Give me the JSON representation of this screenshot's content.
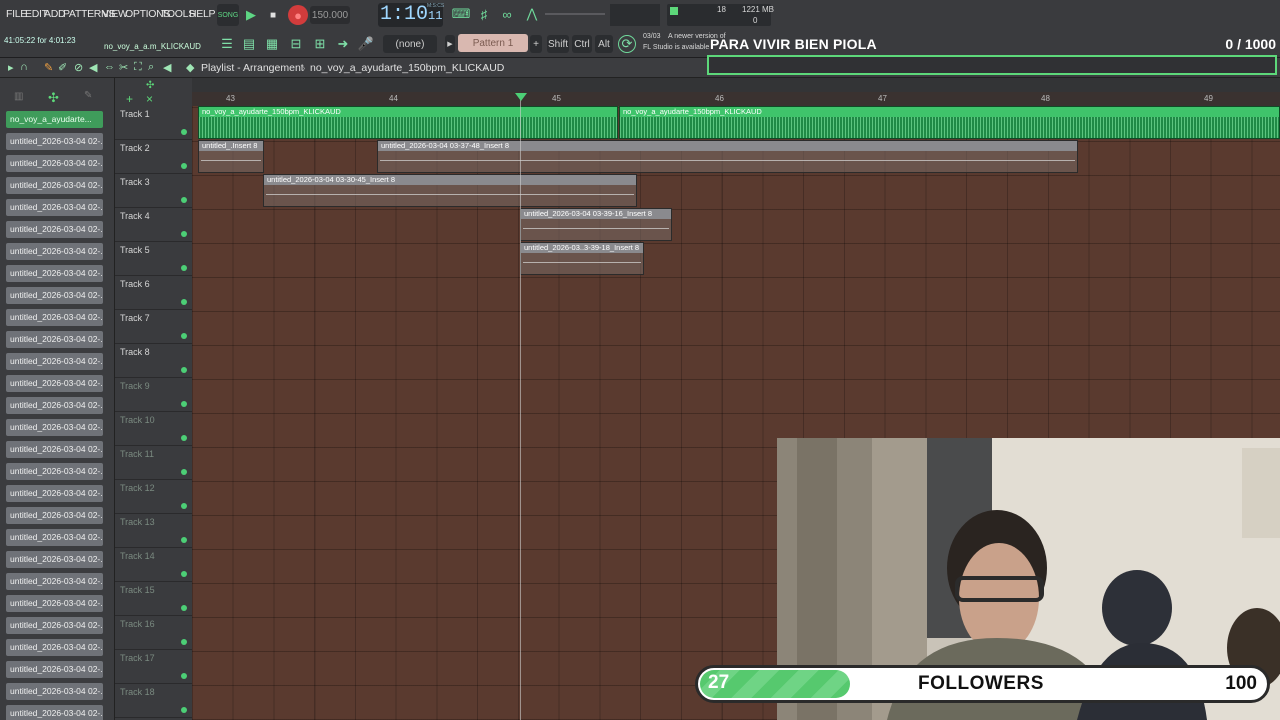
{
  "menu": [
    "FILE",
    "EDIT",
    "ADD",
    "PATTERNS",
    "VIEW",
    "OPTIONS",
    "TOOLS",
    "HELP"
  ],
  "transport": {
    "mode": "SONG",
    "tempo": "150.000",
    "time": "1:10",
    "time_small": "11",
    "time_label": "M:S:CS"
  },
  "status": {
    "cpu": "18",
    "mem": "1221 MB",
    "voices": "0",
    "elapsed": "41:05:22 for 4:01:23",
    "project_short": "no_voy_a_a.m_KLICKAUD"
  },
  "toolbar": {
    "snap": "(none)",
    "pattern": "Pattern 1",
    "shift": "Shift",
    "ctrl": "Ctrl",
    "alt": "Alt",
    "update_date": "03/03",
    "update_text1": "A newer version of",
    "update_text2": "FL Studio is available"
  },
  "stream": {
    "title": "PARA VIVIR BIEN PIOLA",
    "count": "0",
    "goal": "/ 1000"
  },
  "playlist": {
    "title": "Playlist - Arrangement",
    "song": "no_voy_a_ayudarte_150bpm_KLICKAUD"
  },
  "ruler": [
    "43",
    "44",
    "45",
    "46",
    "47",
    "48",
    "49"
  ],
  "clips_panel": [
    "no_voy_a_ayudarte...",
    "untitled_2026-03-04 02-...",
    "untitled_2026-03-04 02-...",
    "untitled_2026-03-04 02-...",
    "untitled_2026-03-04 02-...",
    "untitled_2026-03-04 02-...",
    "untitled_2026-03-04 02-...",
    "untitled_2026-03-04 02-...",
    "untitled_2026-03-04 02-...",
    "untitled_2026-03-04 02-...",
    "untitled_2026-03-04 02-...",
    "untitled_2026-03-04 02-...",
    "untitled_2026-03-04 02-...",
    "untitled_2026-03-04 02-...",
    "untitled_2026-03-04 02-...",
    "untitled_2026-03-04 02-...",
    "untitled_2026-03-04 02-...",
    "untitled_2026-03-04 02-...",
    "untitled_2026-03-04 02-...",
    "untitled_2026-03-04 02-...",
    "untitled_2026-03-04 02-...",
    "untitled_2026-03-04 02-...",
    "untitled_2026-03-04 02-...",
    "untitled_2026-03-04 02-...",
    "untitled_2026-03-04 02-...",
    "untitled_2026-03-04 02-...",
    "untitled_2026-03-04 02-...",
    "untitled_2026-03-04 02-..."
  ],
  "tracks": [
    "Track 1",
    "Track 2",
    "Track 3",
    "Track 4",
    "Track 5",
    "Track 6",
    "Track 7",
    "Track 8",
    "Track 9",
    "Track 10",
    "Track 11",
    "Track 12",
    "Track 13",
    "Track 14",
    "Track 15",
    "Track 16",
    "Track 17",
    "Track 18"
  ],
  "clip_labels": {
    "audio_a": "no_voy_a_ayudarte_150bpm_KLICKAUD",
    "audio_b": "no_voy_a_ayudarte_150bpm_KLICKAUD",
    "t2a": "untitled_.Insert 8",
    "t2b": "untitled_2026-03-04 03-37-48_Insert 8",
    "t3": "untitled_2026-03-04 03-30-45_Insert 8",
    "t4": "untitled_2026-03-04 03-39-16_Insert 8",
    "t5": "untitled_2026-03..3-39-18_Insert 8"
  },
  "followers": {
    "current": "27",
    "label": "FOLLOWERS",
    "goal": "100",
    "progress": 0.27
  },
  "colors": {
    "accent": "#4ccf76",
    "grid": "#5a3a2f",
    "panel": "#3b3c3f"
  }
}
